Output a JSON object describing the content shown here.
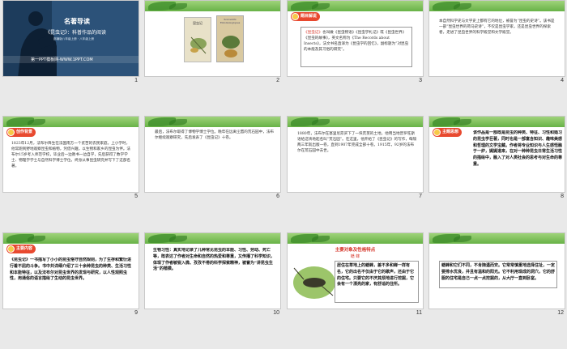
{
  "slides": [
    {
      "number": "1",
      "title": "名著导读",
      "subtitle": "《昆虫记》：科普作品的阅读",
      "note": "部编版八年级上册 · 八年级上册",
      "footer": "第一PPT模板网-WWW.1PPT.COM"
    },
    {
      "number": "2",
      "book_cover_1": "昆虫记",
      "book_cover_2": "Souvenirs Entomologiques"
    },
    {
      "number": "3",
      "badge": "题目解说",
      "text_highlight": "《昆虫记》",
      "text": "也叫做《昆虫物语》《昆虫学札记》或《昆虫世界》《昆虫的故事》，英文名称为《The Records about Insects》，法文书名直译为《昆虫学的回忆》，副标题为“对昆虫的本能及其习俗的研究”。"
    },
    {
      "number": "4",
      "text": "本自然科学史与文学史上都有它的地位，被誉为“昆虫的史诗”。该书是一部“昆虫世界的荷马史诗”，不仅是昆虫学家，还是昆虫世界的探索者，走进了昆虫世界的科学殿堂和文学殿堂。"
    },
    {
      "number": "5",
      "badge": "创作背景",
      "text": "1823年12月，法布尔降生在法国南方一个贫苦的农民家庭。上小学时，他常跑到野地观察昆虫和植物，凭借兴趣，以生物和家乡的昆虫为伴。法布尔15岁考入师范学校，毕业后一边教书一边自学，先后获得了数学学士、物理学学士与自然科学博士学位，终身从事昆虫研究并写下了这部名著。"
    },
    {
      "number": "6",
      "text": "最后，法布尔取得了博物学博士学位。晚年在远离尘嚣的荒石园中，法布尔继续观察研究，先后发表了《昆虫记》十卷。"
    },
    {
      "number": "7",
      "text": "1880年，法布尔在塞里尼昂买下了一块荒芜的土地，他用当地普罗旺斯语给这块地起名叫“荒石园”。在这里，他开始了《昆虫记》的写作，每隔两三年就出版一卷，直到1907年完成全部十卷。1915年，92岁的法布尔在荒石园中去世。"
    },
    {
      "number": "8",
      "badge": "主题思想",
      "text": "该作品是一部既是昆虫的种类、特征、习性和婚习的昆虫学巨著，同时也是一部富含知识、趣味美感和哲理的文学宝藏。作者将专业知识与人生感悟融于一炉，娓娓道来，在对一种种昆虫日常生活习性的描绘中，融入了对人类社会的思考与对生命的尊重。"
    },
    {
      "number": "9",
      "badge": "主要内容",
      "text": "《昆虫记》一书描写了小小的昆虫恪守自然规则，为了生存和繁衍进行着不屈的斗争。书中共详细介绍了三十余种昆虫的种类、生活习性和本能特征，以及法布尔对昆虫世界的发现与研究，以人性观照虫性，用通俗的语言描绘了生动的昆虫世界。"
    },
    {
      "number": "10",
      "text": "生物习性：真实地记录了几种常见昆虫的本能、习性、劳动、死亡等，既表达了作者对生命和自然的热爱和尊重，又传播了科学知识，体现了作者敏锐入微、孜孜不倦的科学探索精神，被誉为“讲昆虫生活”的楷模。"
    },
    {
      "number": "11",
      "title": "主要对象及性格特点",
      "subtitle": "蟋 蟀",
      "text": "居住在草地上的蟋蟀，差不多和蝉一样有名，它的出名不仅由于它的歌声，还由于它的住宅。只要它的不厌其烦地进行挖掘，它会有一个漂亮的家，有舒适的住所。"
    },
    {
      "number": "12",
      "text": "蟋蟀和它们不同，不肯随遇而安。它常常慎重地选择住址，一定要排水优良，并且有温和的阳光。它不利用现成的洞穴，它的舒服的住宅是自己一点一点挖掘的，从大厅一直到卧室。"
    }
  ]
}
